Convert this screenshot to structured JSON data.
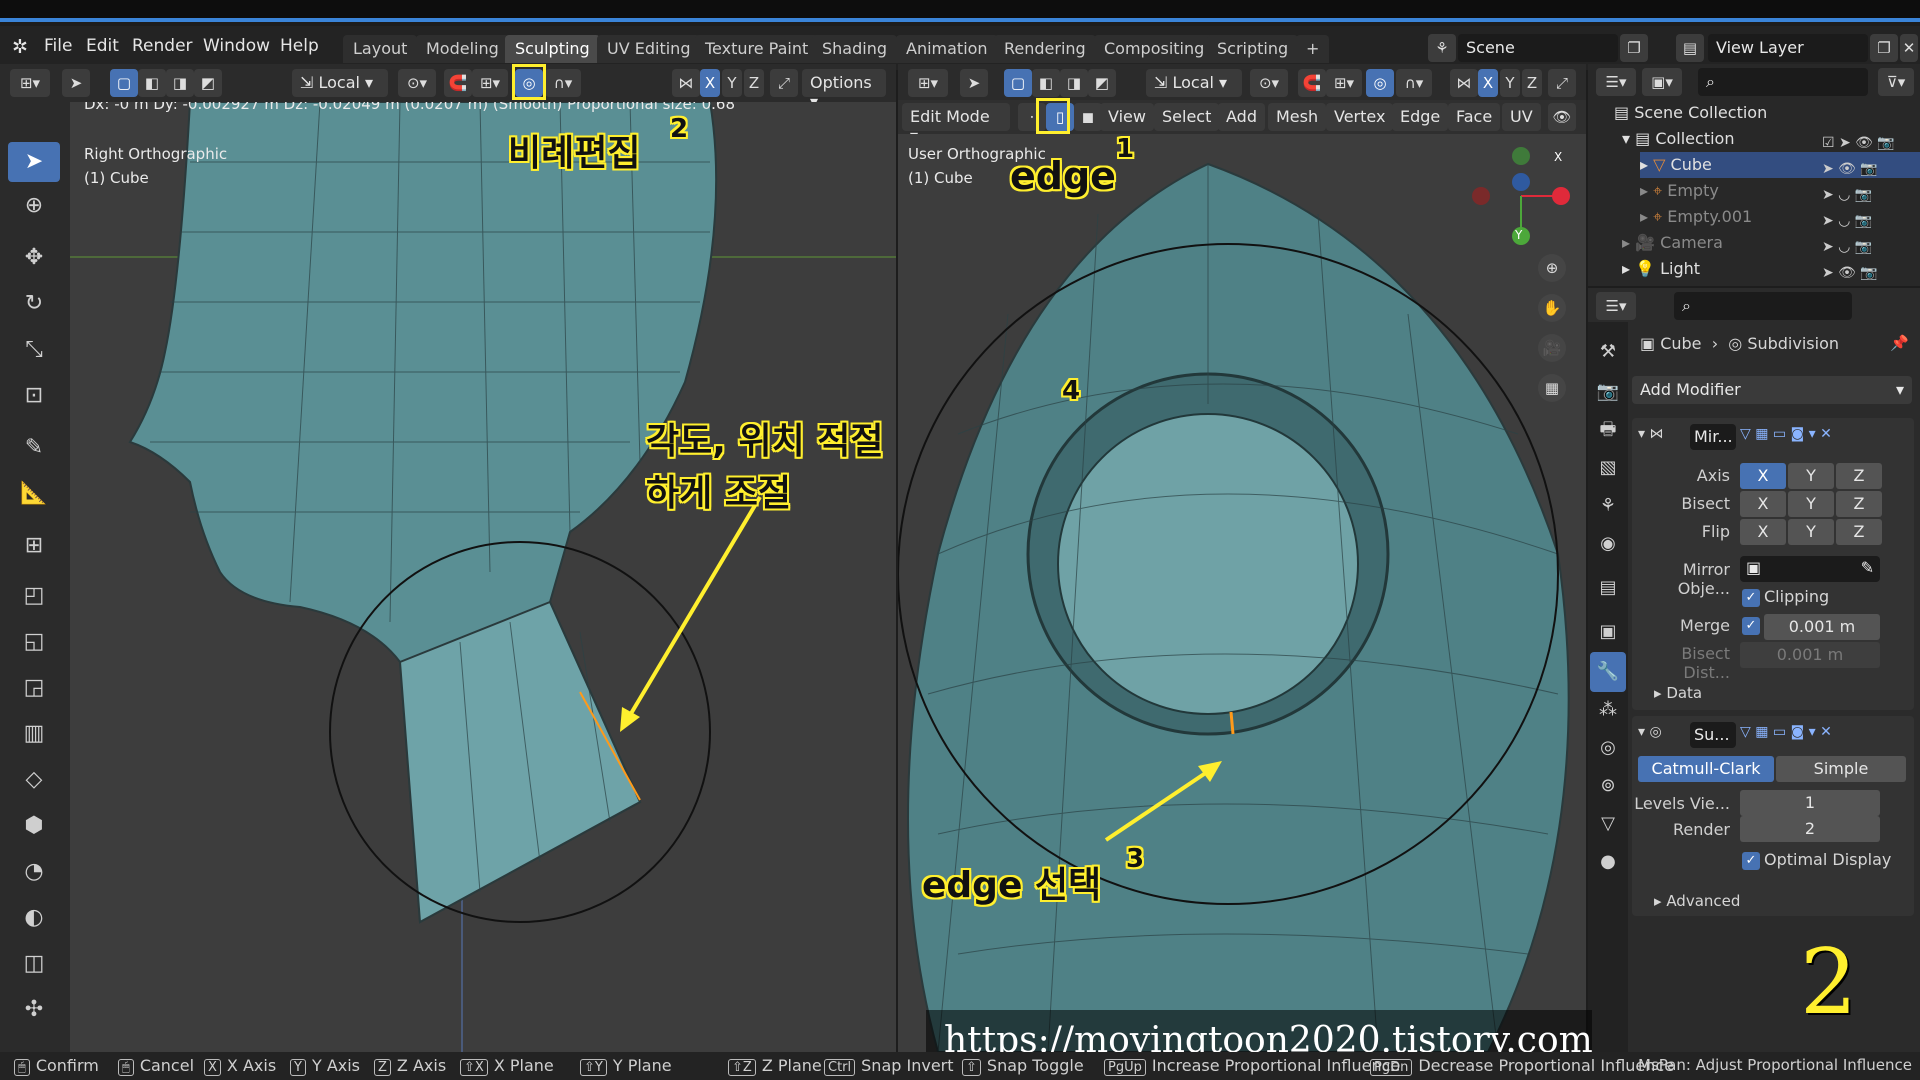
{
  "app": {
    "menu": [
      "File",
      "Edit",
      "Render",
      "Window",
      "Help"
    ],
    "workspaces": [
      "Layout",
      "Modeling",
      "Sculpting",
      "UV Editing",
      "Texture Paint",
      "Shading",
      "Animation",
      "Rendering",
      "Compositing",
      "Scripting",
      "+"
    ],
    "scene": "Scene",
    "view_layer": "View Layer"
  },
  "left_header": {
    "orientation": "Local",
    "axes": [
      "X",
      "Y",
      "Z"
    ],
    "options": "Options"
  },
  "left_viewport": {
    "status": "Dx: -0 m  Dy: -0.002927 m  Dz: -0.02049 m (0.0207 m) (Smooth)   Proportional size: 0.68",
    "view_name": "Right Orthographic",
    "object": "(1) Cube"
  },
  "right_header": {
    "orientation": "Local",
    "axes": [
      "X",
      "Y",
      "Z"
    ],
    "mode": "Edit Mode",
    "menus": [
      "View",
      "Select",
      "Add",
      "Mesh",
      "Vertex",
      "Edge",
      "Face",
      "UV"
    ]
  },
  "right_viewport": {
    "view_name": "User Orthographic",
    "object": "(1) Cube",
    "gizmo": {
      "x": "X",
      "y": "Y"
    }
  },
  "annotations": {
    "prop_edit": "비례편집",
    "n2": "2",
    "edge": "edge",
    "n1": "1",
    "adjust": "각도, 위치 적절하게 조절",
    "n4": "4",
    "edge_select": "edge 선택",
    "n3": "3",
    "big2": "2"
  },
  "outliner": {
    "root": "Scene Collection",
    "collection": "Collection",
    "items": [
      "Cube",
      "Empty",
      "Empty.001",
      "Camera",
      "Light"
    ]
  },
  "properties": {
    "breadcrumb_obj": "Cube",
    "breadcrumb_mod": "Subdivision",
    "add_modifier": "Add Modifier",
    "mirror": {
      "name": "Mir...",
      "axis_label": "Axis",
      "bisect_label": "Bisect",
      "flip_label": "Flip",
      "axes": [
        "X",
        "Y",
        "Z"
      ],
      "mirror_obj_label": "Mirror Obje...",
      "clipping": "Clipping",
      "merge_label": "Merge",
      "merge_value": "0.001 m",
      "bisect_dist_label": "Bisect Dist...",
      "bisect_dist_value": "0.001 m",
      "data": "Data"
    },
    "subsurf": {
      "name": "Su...",
      "catmull": "Catmull-Clark",
      "simple": "Simple",
      "levels_label": "Levels Vie...",
      "levels_value": "1",
      "render_label": "Render",
      "render_value": "2",
      "optimal": "Optimal Display",
      "advanced": "Advanced"
    }
  },
  "status_bar": {
    "confirm": "Confirm",
    "cancel": "Cancel",
    "x_axis": "X Axis",
    "y_axis": "Y Axis",
    "z_axis": "Z Axis",
    "x_plane": "X Plane",
    "y_plane": "Y Plane",
    "z_plane": "Z Plane",
    "snap_invert": "Snap Invert",
    "snap_toggle": "Snap Toggle",
    "increase": "Increase Proportional Influence",
    "decrease": "Decrease Proportional Influence",
    "mspan": "MsPan: Adjust Proportional Influence"
  },
  "watermark": "https://movingtoon2020.tistory.com"
}
